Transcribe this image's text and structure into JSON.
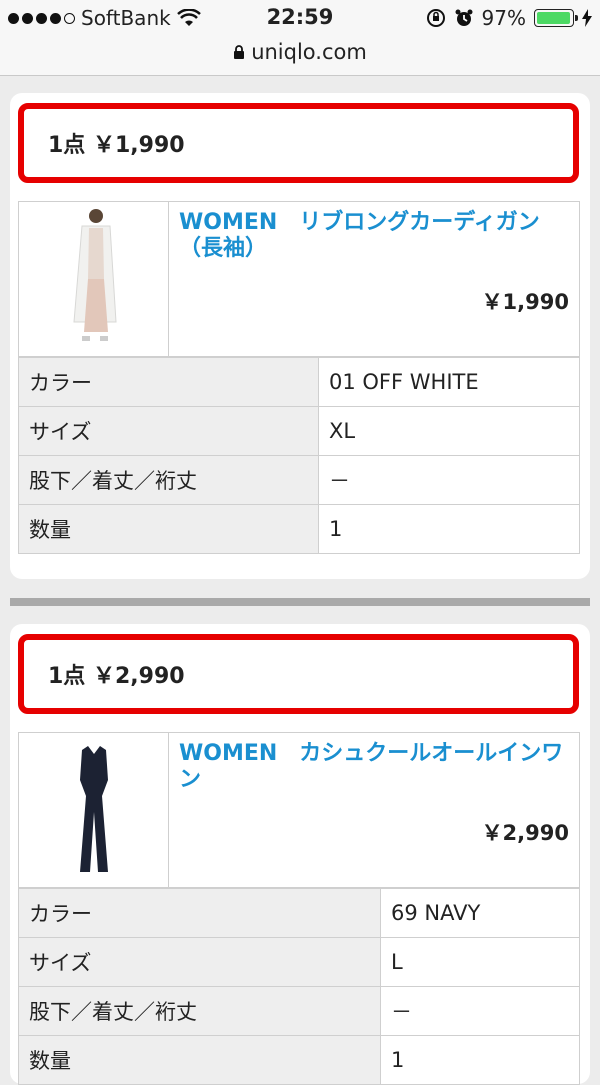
{
  "status": {
    "carrier": "SoftBank",
    "time": "22:59",
    "battery": "97%",
    "battery_level": 0.97,
    "url": "uniqlo.com"
  },
  "items": [
    {
      "summary": "1点 ￥1,990",
      "title": "WOMEN　リブロングカーディガン（長袖）",
      "price": "￥1,990",
      "details": [
        {
          "label": "カラー",
          "value": "01 OFF WHITE"
        },
        {
          "label": "サイズ",
          "value": "XL"
        },
        {
          "label": "股下／着丈／裄丈",
          "value": "－"
        },
        {
          "label": "数量",
          "value": "1"
        }
      ]
    },
    {
      "summary": "1点 ￥2,990",
      "title": "WOMEN　カシュクールオールインワン",
      "price": "￥2,990",
      "details": [
        {
          "label": "カラー",
          "value": "69 NAVY"
        },
        {
          "label": "サイズ",
          "value": "L"
        },
        {
          "label": "股下／着丈／裄丈",
          "value": "－"
        },
        {
          "label": "数量",
          "value": "1"
        }
      ]
    }
  ]
}
